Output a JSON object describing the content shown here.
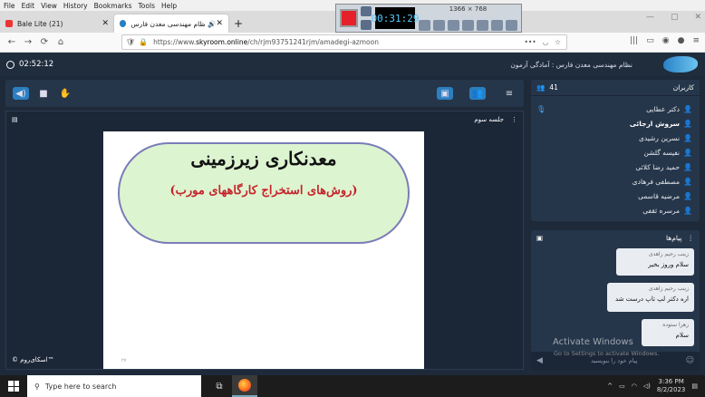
{
  "menubar": {
    "items": [
      "File",
      "Edit",
      "View",
      "History",
      "Bookmarks",
      "Tools",
      "Help"
    ]
  },
  "tabs": [
    {
      "label": "Bale Lite (21)",
      "close": "✕"
    },
    {
      "label": "نظام مهندسی معدن فارس -",
      "close": "✕"
    }
  ],
  "newtab": "+",
  "url": {
    "prefix": "https://www.",
    "domain": "skyroom.online",
    "path": "/ch/rjm93751241rjm/amadegi-azmoon"
  },
  "recorder": {
    "time": "00:31:29",
    "resolution": "1366 × 768"
  },
  "header": {
    "clock": "02:52:12",
    "title": "نظام مهندسی معدن فارس : آمادگی آزمون"
  },
  "panel": {
    "title": "جلسه سوم",
    "brand": "© اسکای‌روم™"
  },
  "slide": {
    "line1": "معدنکاری زیرزمینی",
    "line2": "(روش‌های استخراج کارگاههای مورب)",
    "page": "۲۷"
  },
  "users": {
    "title": "کاربران",
    "count": "41",
    "items": [
      {
        "name": "دکتر عطایی",
        "bold": false
      },
      {
        "name": "سروش ارجائی",
        "bold": true
      },
      {
        "name": "نسرین رشیدی",
        "bold": false
      },
      {
        "name": "نفیسه گلشن",
        "bold": false
      },
      {
        "name": "حمید رضا کلائی",
        "bold": false
      },
      {
        "name": "مصطفی فرهادی",
        "bold": false
      },
      {
        "name": "مرضیه قاسمی",
        "bold": false
      },
      {
        "name": "مرسره ثقفی",
        "bold": false
      }
    ]
  },
  "chat": {
    "title": "پیام‌ها",
    "placeholder": "پیام خود را بنویسید",
    "messages": [
      {
        "sender": "زینب رحیم زاهدی",
        "body": "سلام وروز بخیر"
      },
      {
        "sender": "زینب رحیم زاهدی",
        "body": "اره دکتر لپ تاپ درست شد"
      },
      {
        "sender": "زهرا ستوده",
        "body": "سلام"
      }
    ]
  },
  "watermark": {
    "line1": "Activate Windows",
    "line2": "Go to Settings to activate Windows."
  },
  "taskbar": {
    "search_placeholder": "Type here to search",
    "time": "3:36 PM",
    "date": "8/2/2023"
  }
}
